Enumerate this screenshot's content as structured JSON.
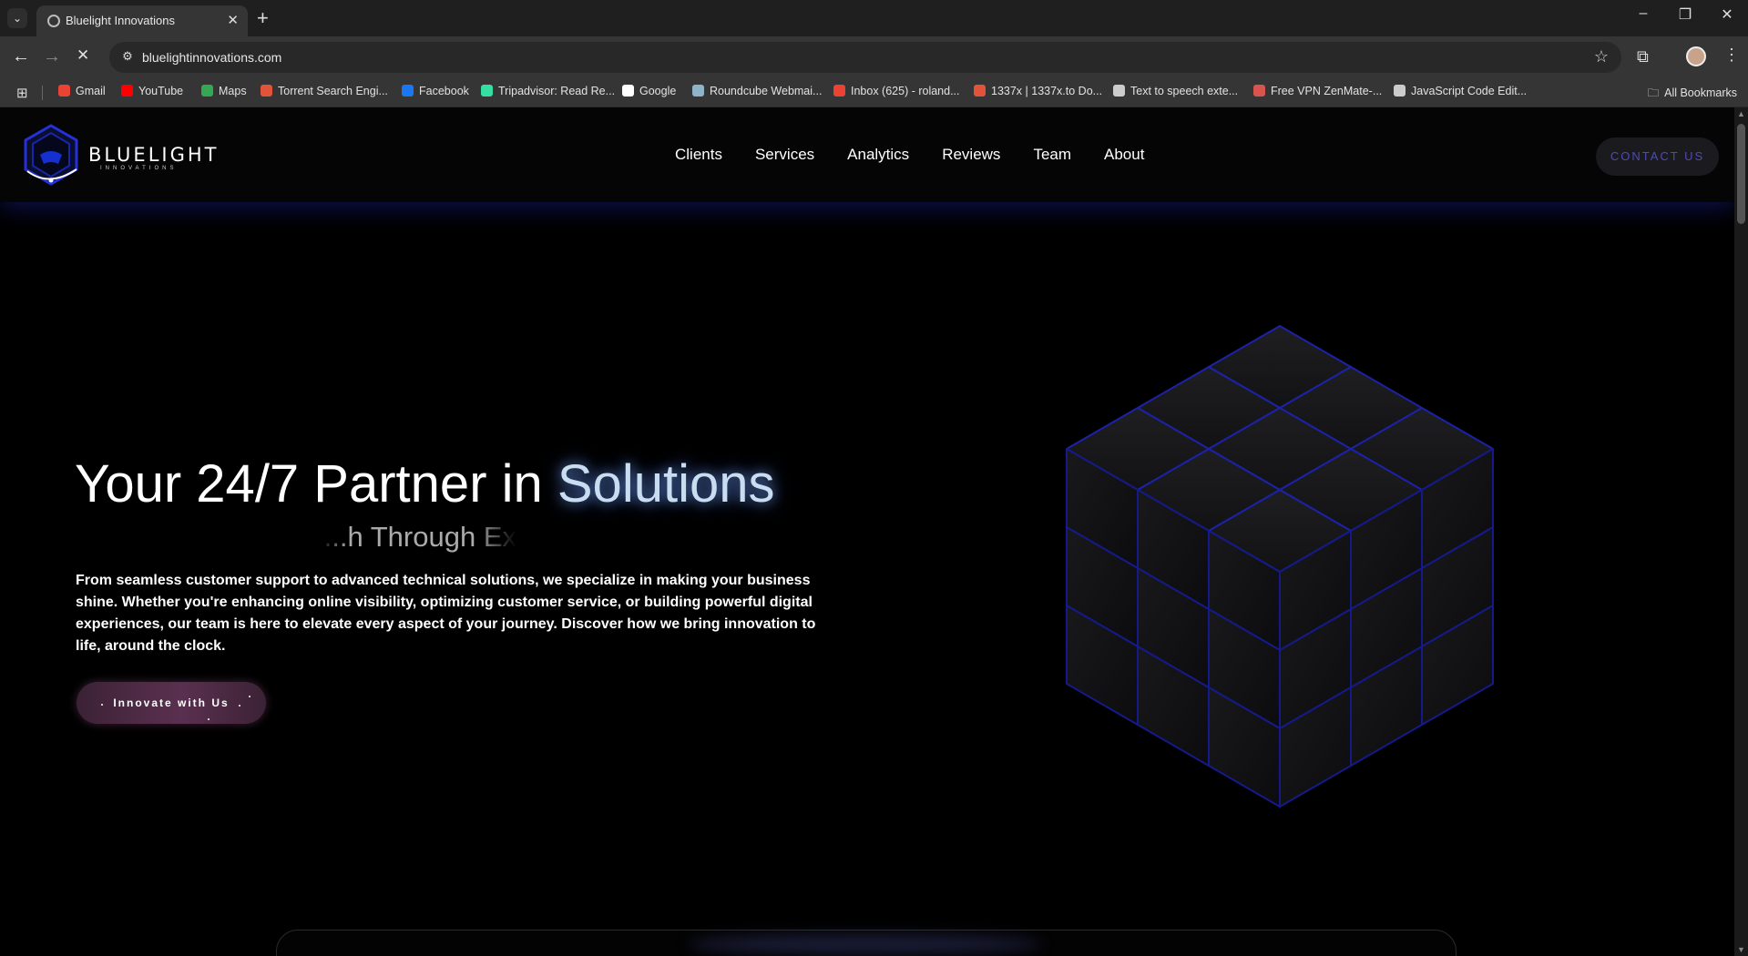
{
  "browser": {
    "tab_title": "Bluelight Innovations",
    "url": "bluelightinnovations.com",
    "window_controls": {
      "minimize": "–",
      "restore": "❐",
      "close": "✕"
    },
    "bookmarks": [
      {
        "label": "Gmail",
        "icon": "gmail-icon",
        "color": "#ea4335"
      },
      {
        "label": "YouTube",
        "icon": "youtube-icon",
        "color": "#ff0000"
      },
      {
        "label": "Maps",
        "icon": "maps-icon",
        "color": "#34a853"
      },
      {
        "label": "Torrent Search Engi...",
        "icon": "x-icon",
        "color": "#e2543a"
      },
      {
        "label": "Facebook",
        "icon": "facebook-icon",
        "color": "#1877f2"
      },
      {
        "label": "Tripadvisor: Read Re...",
        "icon": "tripadvisor-icon",
        "color": "#34e0a1"
      },
      {
        "label": "Google",
        "icon": "google-icon",
        "color": "#ffffff"
      },
      {
        "label": "Roundcube Webmai...",
        "icon": "roundcube-icon",
        "color": "#8fb3c9"
      },
      {
        "label": "Inbox (625) - roland...",
        "icon": "gmail-icon",
        "color": "#ea4335"
      },
      {
        "label": "1337x | 1337x.to Do...",
        "icon": "x-icon",
        "color": "#e2543a"
      },
      {
        "label": "Text to speech exte...",
        "icon": "globe-icon",
        "color": "#cccccc"
      },
      {
        "label": "Free VPN ZenMate-...",
        "icon": "zenmate-icon",
        "color": "#d9534f"
      },
      {
        "label": "JavaScript Code Edit...",
        "icon": "globe-icon",
        "color": "#cccccc"
      }
    ],
    "all_bookmarks": "All Bookmarks"
  },
  "site": {
    "logo_text": "BLUELIGHT",
    "logo_subtext": "INNOVATIONS",
    "nav": [
      "Clients",
      "Services",
      "Analytics",
      "Reviews",
      "Team",
      "About"
    ],
    "contact_button": "CONTACT US",
    "accent_color": "#4c4ab8"
  },
  "hero": {
    "title_prefix": "Your 24/7 Partner in ",
    "title_accent": "Solutions",
    "typewriter_text": "...h Through Ex",
    "description": "From seamless customer support to advanced technical solutions, we specialize in making your business shine. Whether you're enhancing online visibility, optimizing customer service, or building powerful digital experiences, our team is here to elevate every aspect of your journey. Discover how we bring innovation to life, around the clock.",
    "cta_button": "Innovate with Us"
  }
}
